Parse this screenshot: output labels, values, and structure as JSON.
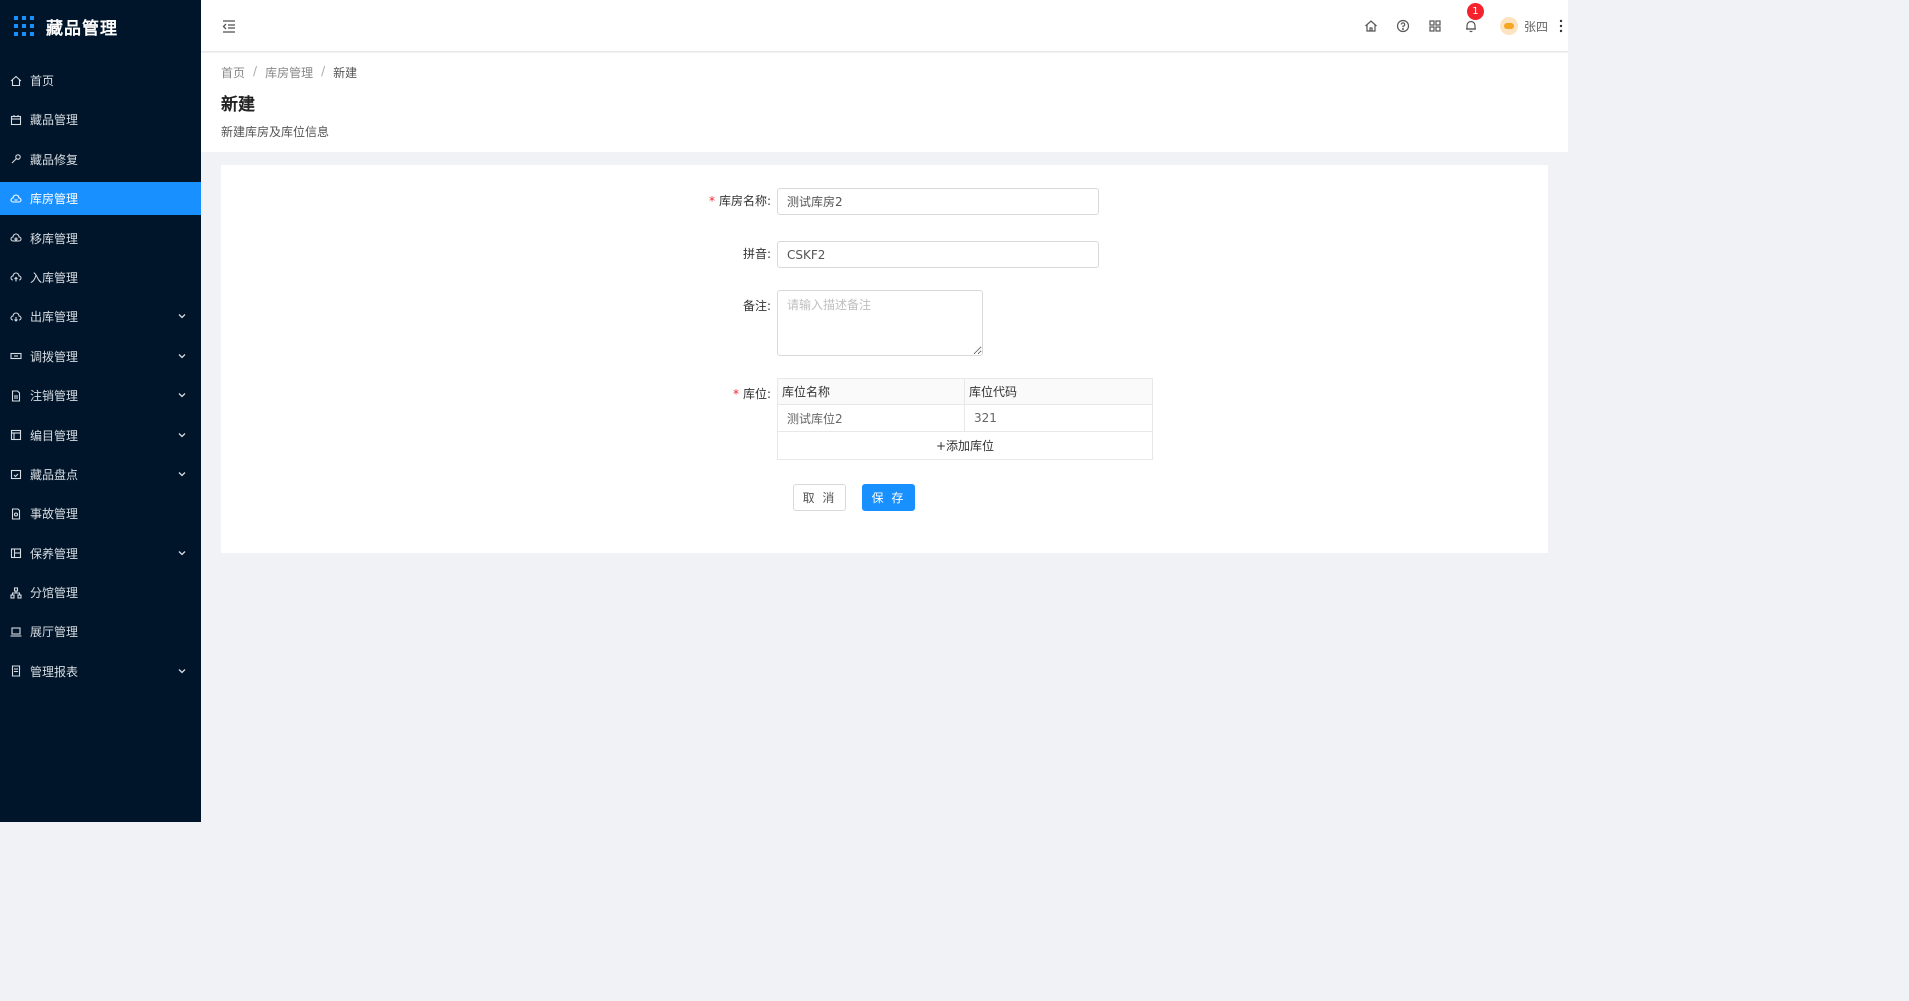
{
  "app": {
    "title": "藏品管理"
  },
  "sidebar": {
    "items": [
      {
        "label": "首页",
        "icon": "home-icon",
        "expandable": false,
        "active": false
      },
      {
        "label": "藏品管理",
        "icon": "calendar-icon",
        "expandable": false,
        "active": false
      },
      {
        "label": "藏品修复",
        "icon": "wrench-icon",
        "expandable": false,
        "active": false
      },
      {
        "label": "库房管理",
        "icon": "cloud-icon",
        "expandable": false,
        "active": true
      },
      {
        "label": "移库管理",
        "icon": "cloud-sync-icon",
        "expandable": false,
        "active": false
      },
      {
        "label": "入库管理",
        "icon": "cloud-upload-icon",
        "expandable": false,
        "active": false
      },
      {
        "label": "出库管理",
        "icon": "cloud-download-icon",
        "expandable": true,
        "active": false
      },
      {
        "label": "调拨管理",
        "icon": "transfer-icon",
        "expandable": true,
        "active": false
      },
      {
        "label": "注销管理",
        "icon": "file-icon",
        "expandable": true,
        "active": false
      },
      {
        "label": "编目管理",
        "icon": "catalog-icon",
        "expandable": true,
        "active": false
      },
      {
        "label": "藏品盘点",
        "icon": "calendar-check-icon",
        "expandable": true,
        "active": false
      },
      {
        "label": "事故管理",
        "icon": "file-search-icon",
        "expandable": false,
        "active": false
      },
      {
        "label": "保养管理",
        "icon": "build-icon",
        "expandable": true,
        "active": false
      },
      {
        "label": "分馆管理",
        "icon": "cluster-icon",
        "expandable": false,
        "active": false
      },
      {
        "label": "展厅管理",
        "icon": "laptop-icon",
        "expandable": false,
        "active": false
      },
      {
        "label": "管理报表",
        "icon": "report-icon",
        "expandable": true,
        "active": false
      }
    ]
  },
  "header": {
    "notification_count": "1",
    "username": "张四"
  },
  "breadcrumb": {
    "items": [
      "首页",
      "库房管理",
      "新建"
    ]
  },
  "page": {
    "title": "新建",
    "description": "新建库房及库位信息"
  },
  "form": {
    "name_label": "库房名称:",
    "name_value": "测试库房2",
    "pinyin_label": "拼音:",
    "pinyin_value": "CSKF2",
    "remark_label": "备注:",
    "remark_placeholder": "请输入描述备注",
    "location_label": "库位:",
    "table": {
      "headers": [
        "库位名称",
        "库位代码"
      ],
      "rows": [
        [
          "测试库位2",
          "321"
        ]
      ],
      "add_label": "+添加库位"
    },
    "cancel_label": "取 消",
    "save_label": "保 存"
  },
  "colors": {
    "sidebar_bg": "#001529",
    "accent": "#1890ff",
    "required": "#f5222d"
  }
}
